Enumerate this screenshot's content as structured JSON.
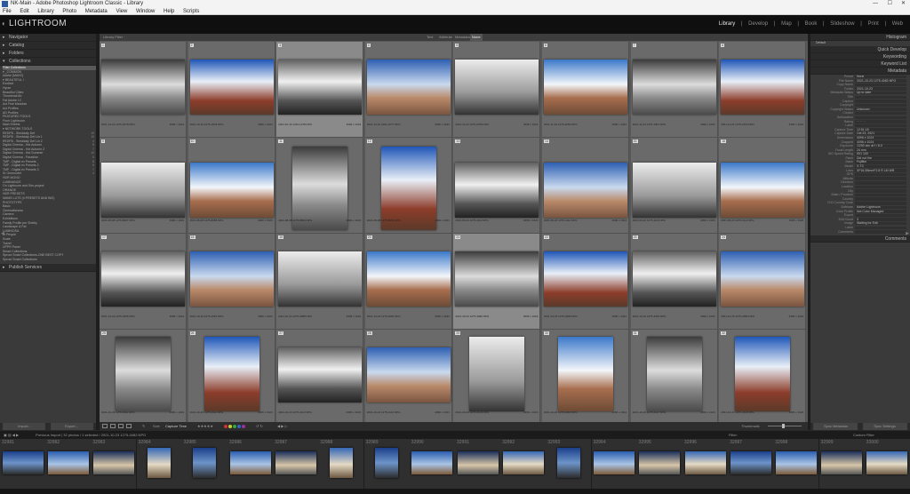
{
  "window": {
    "title": "NK-Main - Adobe Photoshop Lightroom Classic - Library",
    "controls": [
      "—",
      "☐",
      "✕"
    ]
  },
  "menu": [
    "File",
    "Edit",
    "Library",
    "Photo",
    "Metadata",
    "View",
    "Window",
    "Help",
    "Scripts"
  ],
  "app": {
    "logo": "LIGHTROOM"
  },
  "modules": [
    "Library",
    "Develop",
    "Map",
    "Book",
    "Slideshow",
    "Print",
    "Web"
  ],
  "active_module": "Library",
  "left_panel": {
    "sections": [
      "Navigator",
      "Catalog",
      "Folders",
      "Collections"
    ],
    "collections": [
      {
        "label": "Filter Collections",
        "sel": true
      },
      {
        "label": "▾ _COMMON",
        "count": ""
      },
      {
        "label": "  Adobe [MANY]",
        "count": ""
      },
      {
        "label": "  ▾ BEAUTIFUL I",
        "count": ""
      },
      {
        "label": "    Exotixel",
        "count": ""
      },
      {
        "label": "    Hyrax",
        "count": ""
      },
      {
        "label": "    Beautiful Cities",
        "count": ""
      },
      {
        "label": "    Thumbnail Ab",
        "count": ""
      },
      {
        "label": "    Fat Adobe LC",
        "count": ""
      },
      {
        "label": "  Act Fine Meadow",
        "count": ""
      },
      {
        "label": "  Act Profiles",
        "count": ""
      },
      {
        "label": "  AD Profiles",
        "count": ""
      },
      {
        "label": "  FEATURED TOOLS",
        "count": ""
      },
      {
        "label": "  From Lightroom",
        "count": ""
      },
      {
        "label": "  Main Sheetz",
        "count": ""
      },
      {
        "label": "  ▾ NETWORK TOOLS",
        "count": ""
      },
      {
        "label": "    REDFB - Sheddaty Def",
        "count": "19"
      },
      {
        "label": "    REDFB - Sheddaty Def Lin 1",
        "count": "10"
      },
      {
        "label": "    REDFB - Sheddaty Def Lin 2",
        "count": "4"
      },
      {
        "label": "    Digital Cinema - Hot Autumn",
        "count": "5"
      },
      {
        "label": "    Digital Cinema - Hot Autumn 2",
        "count": "7"
      },
      {
        "label": "    Digital Cinema - Hot Summer",
        "count": "10"
      },
      {
        "label": "    Digital Cinema - Paradise",
        "count": "5"
      },
      {
        "label": "    TMP - Digital ex Presets",
        "count": "8"
      },
      {
        "label": "    TMP - Digital ex Presets 2",
        "count": "5"
      },
      {
        "label": "    TMP - Digital ex Presets 3",
        "count": "7"
      },
      {
        "label": "    Sr Ommonfet",
        "count": "4"
      },
      {
        "label": "  HDR MONO",
        "count": ""
      },
      {
        "label": "  LUMINANCE",
        "count": ""
      },
      {
        "label": "  On Lightroom and Sirs project",
        "count": ""
      },
      {
        "label": "  ORANGE",
        "count": ""
      },
      {
        "label": "  HDR PRESETS",
        "count": ""
      },
      {
        "label": "  NMMS LUTS (V.PRESETS AND BIG)",
        "count": ""
      },
      {
        "label": "  PHOTOTYPE",
        "count": ""
      },
      {
        "label": "  Basic",
        "count": ""
      },
      {
        "label": "  Cinematicness",
        "count": ""
      },
      {
        "label": "  Camera",
        "count": ""
      },
      {
        "label": "  Exhibitions",
        "count": ""
      },
      {
        "label": "  Family Profile per Shelby",
        "count": ""
      },
      {
        "label": "  Landscape & Fat",
        "count": ""
      },
      {
        "label": "  LUMINOSA",
        "count": ""
      },
      {
        "label": "  Lr People",
        "count": ""
      },
      {
        "label": "  Scale",
        "count": ""
      },
      {
        "label": "  Travel",
        "count": ""
      },
      {
        "label": "  UPPR Panel",
        "count": ""
      },
      {
        "label": "  Smart Collections",
        "count": ""
      },
      {
        "label": "  Sprout Smart Collections-ONE BEST COPY",
        "count": ""
      },
      {
        "label": "  Sprout Smart Collections",
        "count": ""
      }
    ],
    "publish": "Publish Services",
    "import_label": "Import...",
    "export_label": "Export..."
  },
  "filter_bar": {
    "label": "Library Filter :",
    "options": [
      "Text",
      "Attribute",
      "Metadata",
      "None"
    ],
    "active": "None"
  },
  "grid": {
    "rows": [
      [
        {
          "n": "1",
          "m": [
            "2021-10-10 1275-2078.NPG",
            "4096 x 1024"
          ]
        },
        {
          "n": "2",
          "m": [
            "2021-10-10 1275-1978.NPG",
            "4096 x 1024"
          ]
        },
        {
          "n": "3",
          "m": [
            "2021-10-10 1291-1278.NPG",
            "4096 x 1024"
          ]
        },
        {
          "n": "4",
          "m": [
            "2021-10-10 1291-1277.NPG",
            "4096 x 1024"
          ]
        },
        {
          "n": "5",
          "m": [
            "2021-11-22 1275-2158.NPG",
            "4096 x 1024"
          ]
        },
        {
          "n": "6",
          "m": [
            "2021-11-22 1275-2053.NPG",
            "4096 x 1024"
          ]
        },
        {
          "n": "7",
          "m": [
            "2021-11-23 1276-1002.NPG",
            "4096 x 1024"
          ]
        },
        {
          "n": "8",
          "m": [
            "2021-11-22 1275-2153.NPG",
            "4096 x 1024"
          ]
        }
      ],
      [
        {
          "n": "9",
          "m": [
            "2021-08-08 1275-8987.NPG",
            "4096 x 1024"
          ]
        },
        {
          "n": "10",
          "m": [
            "2021-08-08 1275-8988.NPG",
            "4096 x 1024"
          ]
        },
        {
          "n": "11",
          "m": [
            "2021-08-08 1275-8993.NPG",
            "4096 x 1024"
          ]
        },
        {
          "n": "12",
          "m": [
            "2021-08-08 1275-8992.NPG",
            "4096 x 1024"
          ]
        },
        {
          "n": "13",
          "m": [
            "2021-09-24 1276-1111.NPG",
            "4096 x 1024"
          ]
        },
        {
          "n": "14",
          "m": [
            "2021-09-24 1276-1112.NPG",
            "4096 x 1024"
          ]
        },
        {
          "n": "15",
          "m": [
            "2021-09-24 1276-1113.NPG",
            "4096 x 1024"
          ]
        },
        {
          "n": "16",
          "m": [
            "2021-09-24 1276-1114.NPG",
            "4096 x 1024"
          ]
        }
      ],
      [
        {
          "n": "17",
          "m": [
            "2021-10-23 1275-4066.NPG",
            "4096 x 1024"
          ]
        },
        {
          "n": "18",
          "m": [
            "2021-10-23 1275-4064.NPG",
            "4096 x 1024"
          ]
        },
        {
          "n": "19",
          "m": [
            "2021-10-23 1275-4088.NPG",
            "4096 x 1024"
          ]
        },
        {
          "n": "20",
          "m": [
            "2021-10-23 1275-4081.NPG",
            "4096 x 1024"
          ]
        },
        {
          "n": "21",
          "m": [
            "2021-10-23 1275-4082.NPG",
            "4096 x 1024"
          ]
        },
        {
          "n": "22",
          "m": [
            "2021-10-23 1275-4083.NPG",
            "4096 x 1024"
          ]
        },
        {
          "n": "23",
          "m": [
            "2021-10-23 1275-4094.NPG",
            "4096 x 1024"
          ]
        },
        {
          "n": "24",
          "m": [
            "2021-10-23 1275-4095.NPG",
            "4096 x 1024"
          ]
        }
      ],
      [
        {
          "n": "25",
          "m": [
            "2021-10-23 1275-4111.NPG",
            "4096 x 1024"
          ]
        },
        {
          "n": "26",
          "m": [
            "2021-10-23 1275-4112.NPG",
            "4096 x 1024"
          ]
        },
        {
          "n": "27",
          "m": [
            "2021-10-23 1275-4113.NPG",
            "4096 x 1024"
          ]
        },
        {
          "n": "28",
          "m": [
            "2021-10-23 1275-4114.NPG",
            "4096 x 1024"
          ]
        },
        {
          "n": "29",
          "m": [
            "2021-10-23 1275-4115.NPG",
            "4096 x 1024"
          ]
        },
        {
          "n": "30",
          "m": [
            "2021-10-23 1275-4116.NPG",
            "4096 x 1024"
          ]
        },
        {
          "n": "31",
          "m": [
            "2021-10-23 1275-4117.NPG",
            "4096 x 1024"
          ]
        },
        {
          "n": "32",
          "m": [
            "2021-10-23 1275-4118.NPG",
            "4096 x 1024"
          ]
        }
      ]
    ]
  },
  "toolbar": {
    "sort_label": "Sort:",
    "sort_value": "Capture Time",
    "thumbs_label": "Thumbnails"
  },
  "right_panel": {
    "histogram": "Histogram",
    "quick_develop": "Quick Develop",
    "keywording": "Keywording",
    "keyword_list": "Keyword List",
    "metadata": "Metadata",
    "preset_label": "Default",
    "fields": [
      {
        "l": "Preset",
        "v": "None"
      },
      {
        "l": "File Name",
        "v": "2021-10-23 1275-4082.NPG"
      },
      {
        "l": "Copy Name",
        "v": ""
      },
      {
        "l": "Folder",
        "v": "2021-10-23"
      },
      {
        "l": "Metadata Status",
        "v": "Up to date"
      },
      {
        "l": "Title",
        "v": ""
      },
      {
        "l": "Caption",
        "v": ""
      },
      {
        "l": "Copyright",
        "v": ""
      },
      {
        "l": "Copyright Status",
        "v": "Unknown"
      },
      {
        "l": "Creator",
        "v": ""
      },
      {
        "l": "Sublocation",
        "v": ""
      },
      {
        "l": "Rating",
        "v": "·  ·  ·  ·  ·"
      },
      {
        "l": "Label",
        "v": ""
      },
      {
        "l": "Capture Time",
        "v": "12:51:18"
      },
      {
        "l": "Capture Date",
        "v": "Oct 23, 2021"
      },
      {
        "l": "Dimensions",
        "v": "4096 x 1024"
      },
      {
        "l": "Cropped",
        "v": "4096 x 1024"
      },
      {
        "l": "Exposure",
        "v": "1/250 sec at f / 8.0"
      },
      {
        "l": "Focal Length",
        "v": "24 mm"
      },
      {
        "l": "ISO Speed Rating",
        "v": "ISO 100"
      },
      {
        "l": "Flash",
        "v": "Did not fire"
      },
      {
        "l": "Make",
        "v": "Fujifilm"
      },
      {
        "l": "Model",
        "v": "X-T3"
      },
      {
        "l": "Lens",
        "v": "XF16-55mmF2.8 R LM WR"
      },
      {
        "l": "GPS",
        "v": ""
      },
      {
        "l": "Altitude",
        "v": ""
      },
      {
        "l": "Direction",
        "v": ""
      },
      {
        "l": "Location",
        "v": ""
      },
      {
        "l": "City",
        "v": ""
      },
      {
        "l": "State / Province",
        "v": ""
      },
      {
        "l": "Country",
        "v": ""
      },
      {
        "l": "ISO Country Code",
        "v": ""
      },
      {
        "l": "Software",
        "v": "Adobe Lightroom"
      },
      {
        "l": "Color Profile",
        "v": "Not Color Managed"
      },
      {
        "l": "Export",
        "v": ""
      },
      {
        "l": "Edit Count",
        "v": "3"
      },
      {
        "l": "Image",
        "v": "Waiting for Edit"
      },
      {
        "l": "Label",
        "v": ""
      },
      {
        "l": "Comments",
        "v": ""
      }
    ],
    "comments": "Comments",
    "sync_label": "Sync Metadata",
    "sync_settings": "Sync Settings"
  },
  "filmstrip_bar": {
    "text": "Previous Import | 32 photos / 1 selected / 2021-10-23 1275-4082.NPG",
    "filter": "Filter:",
    "filter_value": "Custom Filter"
  },
  "filmstrip": [
    "32981",
    "32982",
    "32983",
    "32984",
    "32985",
    "32986",
    "32987",
    "32988",
    "32989",
    "32990",
    "32991",
    "32992",
    "32993",
    "32994",
    "32995",
    "32996",
    "32997",
    "32998",
    "32999",
    "33000"
  ]
}
